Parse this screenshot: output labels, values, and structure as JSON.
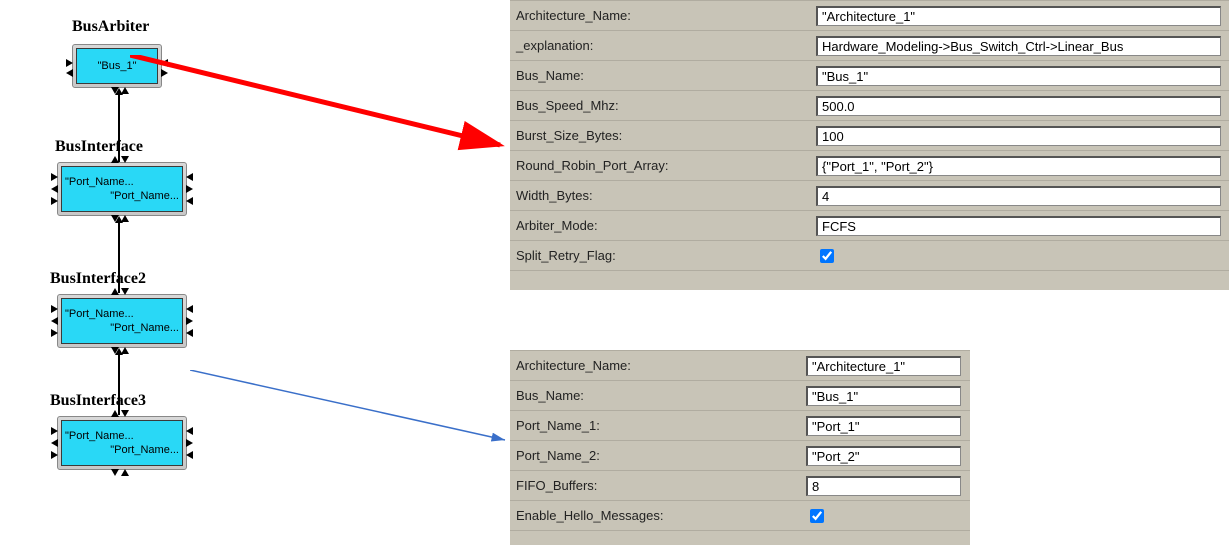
{
  "diagram": {
    "arbiter_title": "BusArbiter",
    "arbiter_label": "\"Bus_1\"",
    "iface1_title": "BusInterface",
    "iface2_title": "BusInterface2",
    "iface3_title": "BusInterface3",
    "port_label": "\"Port_Name..."
  },
  "panel1": {
    "labels": {
      "arch": "Architecture_Name:",
      "expl": "_explanation:",
      "bus": "Bus_Name:",
      "speed": "Bus_Speed_Mhz:",
      "burst": "Burst_Size_Bytes:",
      "rr": "Round_Robin_Port_Array:",
      "width": "Width_Bytes:",
      "mode": "Arbiter_Mode:",
      "split": "Split_Retry_Flag:"
    },
    "values": {
      "arch": "\"Architecture_1\"",
      "expl": "Hardware_Modeling->Bus_Switch_Ctrl->Linear_Bus",
      "bus": "\"Bus_1\"",
      "speed": "500.0",
      "burst": "100",
      "rr": "{\"Port_1\", \"Port_2\"}",
      "width": "4",
      "mode": "FCFS",
      "split_checked": true
    }
  },
  "panel2": {
    "labels": {
      "arch": "Architecture_Name:",
      "bus": "Bus_Name:",
      "p1": "Port_Name_1:",
      "p2": "Port_Name_2:",
      "fifo": "FIFO_Buffers:",
      "hello": "Enable_Hello_Messages:"
    },
    "values": {
      "arch": "\"Architecture_1\"",
      "bus": "\"Bus_1\"",
      "p1": "\"Port_1\"",
      "p2": "\"Port_2\"",
      "fifo": "8",
      "hello_checked": true
    }
  }
}
